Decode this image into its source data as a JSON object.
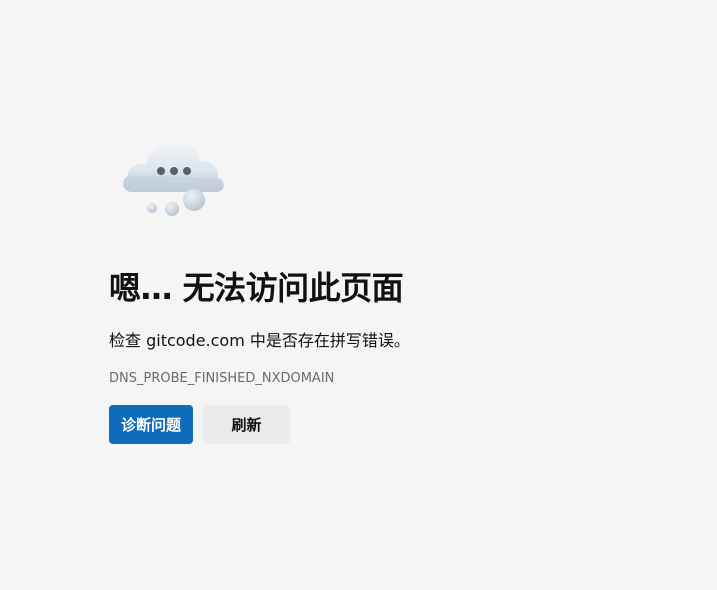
{
  "error": {
    "illustration_icon": "cloud-thinking-icon",
    "title": "嗯… 无法访问此页面",
    "message": "检查 gitcode.com 中是否存在拼写错误。",
    "code": "DNS_PROBE_FINISHED_NXDOMAIN"
  },
  "actions": {
    "diagnose_label": "诊断问题",
    "refresh_label": "刷新"
  },
  "colors": {
    "background": "#f5f5f5",
    "primary_button": "#0f6cbd",
    "secondary_button": "#ebebeb",
    "code_text": "#6b6b6b"
  }
}
